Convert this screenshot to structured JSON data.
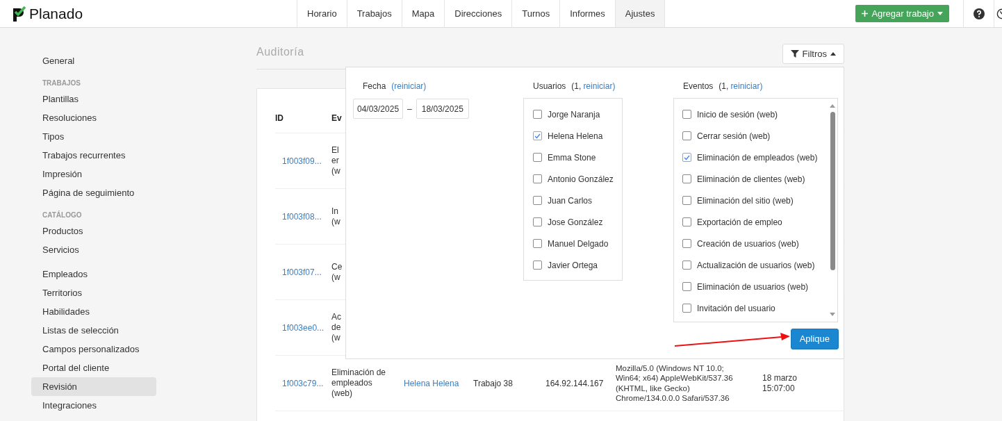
{
  "header": {
    "logo_text": "Planado",
    "nav": [
      {
        "label": "Horario",
        "selected": false
      },
      {
        "label": "Trabajos",
        "selected": false
      },
      {
        "label": "Mapa",
        "selected": false
      },
      {
        "label": "Direcciones",
        "selected": false
      },
      {
        "label": "Turnos",
        "selected": false
      },
      {
        "label": "Informes",
        "selected": false
      },
      {
        "label": "Ajustes",
        "selected": true
      }
    ],
    "add_button": "Agregar trabajo"
  },
  "sidebar": [
    {
      "items": [
        {
          "label": "General",
          "selected": false
        }
      ]
    },
    {
      "heading": "TRABAJOS",
      "items": [
        {
          "label": "Plantillas",
          "selected": false
        },
        {
          "label": "Resoluciones",
          "selected": false
        },
        {
          "label": "Tipos",
          "selected": false
        },
        {
          "label": "Trabajos recurrentes",
          "selected": false
        },
        {
          "label": "Impresión",
          "selected": false
        },
        {
          "label": "Página de seguimiento",
          "selected": false
        }
      ]
    },
    {
      "heading": "CATÁLOGO",
      "items": [
        {
          "label": "Productos",
          "selected": false
        },
        {
          "label": "Servicios",
          "selected": false
        }
      ]
    },
    {
      "items": [
        {
          "label": "Empleados",
          "selected": false
        },
        {
          "label": "Territorios",
          "selected": false
        },
        {
          "label": "Habilidades",
          "selected": false
        },
        {
          "label": "Listas de selección",
          "selected": false
        },
        {
          "label": "Campos personalizados",
          "selected": false
        },
        {
          "label": "Portal del cliente",
          "selected": false
        },
        {
          "label": "Revisión",
          "selected": true
        },
        {
          "label": "Integraciones",
          "selected": false
        }
      ]
    }
  ],
  "page_title": "Auditoría",
  "filter_button": "Filtros",
  "table": {
    "columns": [
      "ID",
      "Ev"
    ],
    "rows": [
      {
        "id": "1f003f09...",
        "event": [
          "El",
          "er",
          "(w"
        ]
      },
      {
        "id": "1f003f08...",
        "event": [
          "In",
          "(w"
        ]
      },
      {
        "id": "1f003f07...",
        "event": [
          "Ce",
          "(w"
        ]
      },
      {
        "id": "1f003ee0...",
        "event": [
          "Ac",
          "de",
          "(w"
        ]
      },
      {
        "id": "1f003c79...",
        "event": [
          "Eliminación de",
          "empleados",
          "(web)"
        ],
        "user": "Helena Helena",
        "job": "Trabajo 38",
        "ip": "164.92.144.167",
        "agent": [
          "Mozilla/5.0 (Windows NT 10.0;",
          "Win64; x64) AppleWebKit/537.36",
          "(KHTML, like Gecko)",
          "Chrome/134.0.0.0 Safari/537.36"
        ],
        "date": [
          "18 marzo",
          "15:07:00"
        ]
      }
    ]
  },
  "filters": {
    "date": {
      "label": "Fecha",
      "reset": "(reiniciar)",
      "from": "04/03/2025",
      "separator": "–",
      "to": "18/03/2025"
    },
    "users": {
      "label": "Usuarios",
      "count": "(1,",
      "reset": "reiniciar)",
      "options": [
        {
          "label": "Jorge Naranja",
          "checked": false
        },
        {
          "label": "Helena Helena",
          "checked": true
        },
        {
          "label": "Emma Stone",
          "checked": false
        },
        {
          "label": "Antonio González",
          "checked": false
        },
        {
          "label": "Juan Carlos",
          "checked": false
        },
        {
          "label": "Jose González",
          "checked": false
        },
        {
          "label": "Manuel Delgado",
          "checked": false
        },
        {
          "label": "Javier Ortega",
          "checked": false
        }
      ]
    },
    "events": {
      "label": "Eventos",
      "count": "(1,",
      "reset": "reiniciar)",
      "options": [
        {
          "label": "Inicio de sesión (web)",
          "checked": false
        },
        {
          "label": "Cerrar sesión (web)",
          "checked": false
        },
        {
          "label": "Eliminación de empleados (web)",
          "checked": true
        },
        {
          "label": "Eliminación de clientes (web)",
          "checked": false
        },
        {
          "label": "Eliminación del sitio (web)",
          "checked": false
        },
        {
          "label": "Exportación de empleo",
          "checked": false
        },
        {
          "label": "Creación de usuarios (web)",
          "checked": false
        },
        {
          "label": "Actualización de usuarios (web)",
          "checked": false
        },
        {
          "label": "Eliminación de usuarios (web)",
          "checked": false
        },
        {
          "label": "Invitación del usuario",
          "checked": false
        }
      ]
    },
    "apply_button": "Aplique"
  }
}
